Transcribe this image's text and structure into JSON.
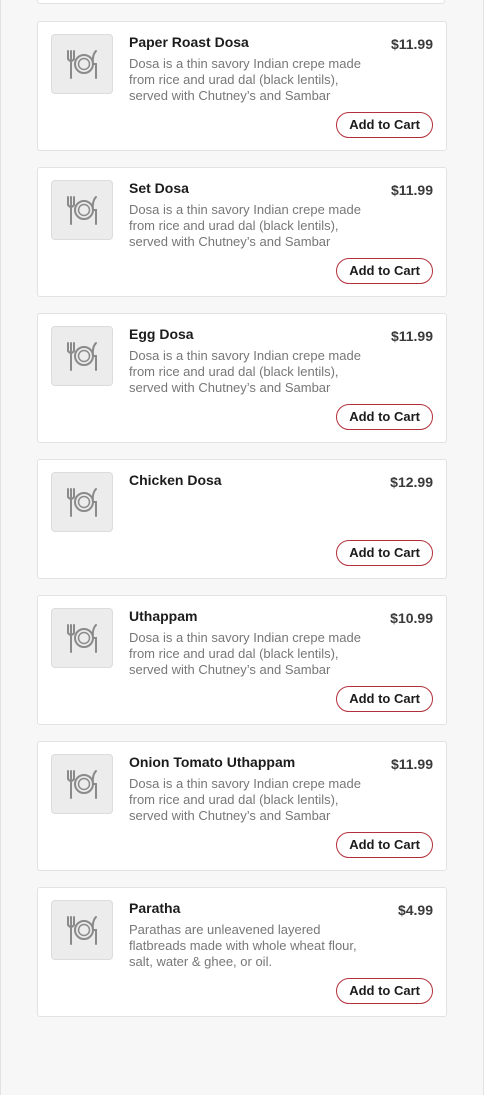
{
  "menu": {
    "button_label": "Add to Cart",
    "placeholder_icon": "plate-fork-knife-icon",
    "accent_color": "#b3303a",
    "items": [
      {
        "name": "Paper Roast Dosa",
        "price": "$11.99",
        "description": "Dosa is a thin savory Indian crepe made from rice and urad dal (black lentils), served with Chutney’s and Sambar"
      },
      {
        "name": "Set Dosa",
        "price": "$11.99",
        "description": "Dosa is a thin savory Indian crepe made from rice and urad dal (black lentils), served with Chutney’s and Sambar"
      },
      {
        "name": "Egg Dosa",
        "price": "$11.99",
        "description": "Dosa is a thin savory Indian crepe made from rice and urad dal (black lentils), served with Chutney’s and Sambar"
      },
      {
        "name": "Chicken Dosa",
        "price": "$12.99",
        "description": ""
      },
      {
        "name": "Uthappam",
        "price": "$10.99",
        "description": "Dosa is a thin savory Indian crepe made from rice and urad dal (black lentils), served with Chutney’s and Sambar"
      },
      {
        "name": "Onion Tomato Uthappam",
        "price": "$11.99",
        "description": "Dosa is a thin savory Indian crepe made from rice and urad dal (black lentils), served with Chutney’s and Sambar"
      },
      {
        "name": "Paratha",
        "price": "$4.99",
        "description": "Parathas are unleavened layered flatbreads made with whole wheat flour, salt, water & ghee, or oil."
      }
    ]
  }
}
